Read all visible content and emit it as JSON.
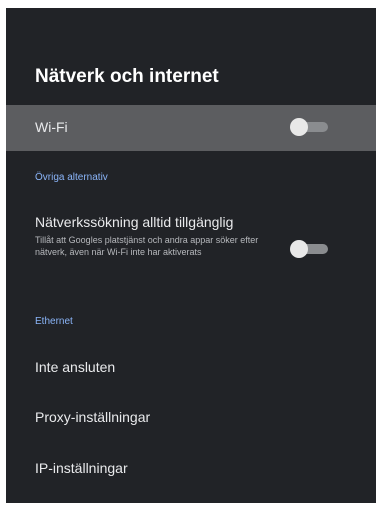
{
  "page": {
    "title": "Nätverk och internet"
  },
  "wifi": {
    "label": "Wi-Fi",
    "enabled": false
  },
  "other_options": {
    "header": "Övriga alternativ",
    "network_scan": {
      "label": "Nätverkssökning alltid tillgänglig",
      "description": "Tillåt att Googles platstjänst och andra appar söker efter nätverk, även när Wi-Fi inte har aktiverats",
      "enabled": false
    }
  },
  "ethernet": {
    "header": "Ethernet",
    "status": "Inte ansluten",
    "proxy_label": "Proxy-inställningar",
    "ip_label": "IP-inställningar"
  },
  "colors": {
    "background": "#212327",
    "focus_highlight": "#5c5d60",
    "section_header": "#8ab4f8",
    "toggle_track_off": "#8a8c8f",
    "toggle_thumb_off": "#e8e8e8"
  }
}
